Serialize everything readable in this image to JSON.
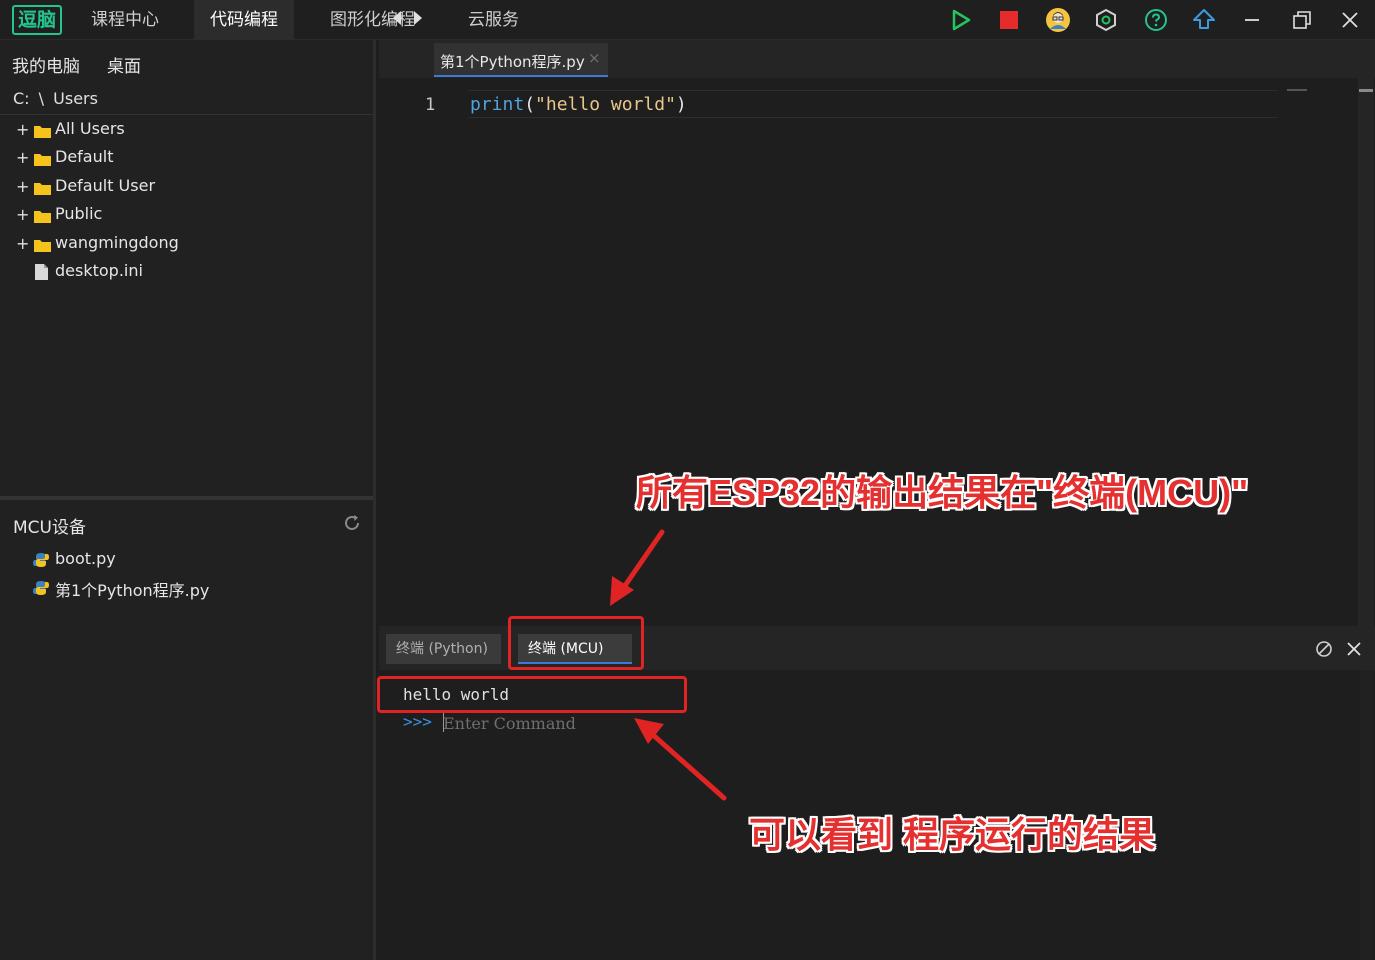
{
  "app": {
    "logo_text": "逗脑",
    "nav": [
      "课程中心",
      "代码编程",
      "图形化编程",
      "云服务"
    ],
    "active_nav": "代码编程"
  },
  "colors": {
    "accent": "#23c48e",
    "run": "#22c55e",
    "stop": "#e52b2b",
    "annotation": "#e02424",
    "tab_underline": "#3a7bd5"
  },
  "sidebar": {
    "tabs": [
      "我的电脑",
      "桌面"
    ],
    "path": {
      "drive": "C:",
      "sep": "\\",
      "folder": "Users"
    },
    "tree": [
      {
        "label": "All Users",
        "type": "folder"
      },
      {
        "label": "Default",
        "type": "folder"
      },
      {
        "label": "Default User",
        "type": "folder"
      },
      {
        "label": "Public",
        "type": "folder"
      },
      {
        "label": "wangmingdong",
        "type": "folder"
      },
      {
        "label": "desktop.ini",
        "type": "file"
      }
    ],
    "mcu_title": "MCU设备",
    "mcu_files": [
      "boot.py",
      "第1个Python程序.py"
    ]
  },
  "editor": {
    "tab_label": "第1个Python程序.py",
    "tab_close": "×",
    "line_number": "1",
    "code": {
      "fn": "print",
      "open": "(",
      "str": "\"hello world\"",
      "close": ")"
    }
  },
  "terminal": {
    "tabs": [
      "终端 (Python)",
      "终端 (MCU)"
    ],
    "active_tab": "终端 (MCU)",
    "output": "hello world",
    "prompt": ">>>",
    "input_placeholder": "Enter Command"
  },
  "annotations": {
    "top": "所有ESP32的输出结果在\"终端(MCU)\"",
    "bottom": "可以看到 程序运行的结果"
  },
  "icons": [
    "run-icon",
    "stop-icon",
    "avatar-icon",
    "settings-hex-icon",
    "help-icon",
    "upload-icon",
    "minimize-icon",
    "restore-icon",
    "close-icon",
    "refresh-icon",
    "folder-icon",
    "file-icon",
    "python-icon",
    "clear-icon"
  ]
}
